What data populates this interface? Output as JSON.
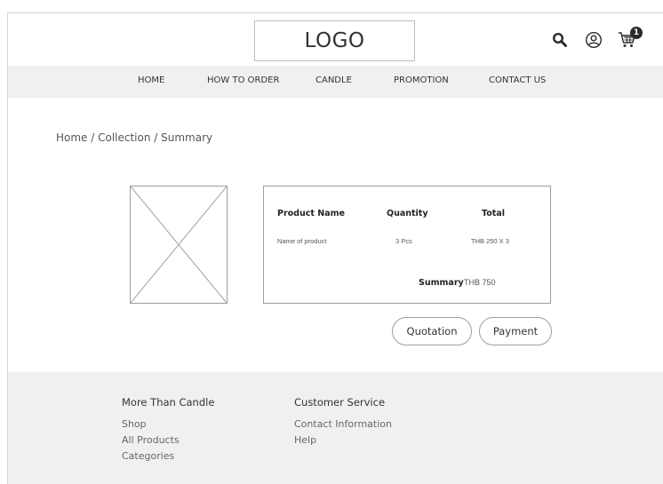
{
  "header": {
    "logo": "LOGO",
    "icons": [
      "search-icon",
      "user-icon",
      "cart-icon"
    ],
    "cart_count": "1"
  },
  "nav": {
    "items": [
      "HOME",
      "HOW TO ORDER",
      "CANDLE",
      "PROMOTION",
      "CONTACT US"
    ]
  },
  "breadcrumb": "Home / Collection / Summary",
  "summary": {
    "headers": {
      "product": "Product Name",
      "quantity": "Quantity",
      "total": "Total"
    },
    "row": {
      "product": "Name of product",
      "quantity": "3 Pcs",
      "total": "THB 250  X  3"
    },
    "summary_label": "Summary",
    "summary_value": "THB 750"
  },
  "actions": {
    "quotation": "Quotation",
    "payment": "Payment"
  },
  "footer": {
    "col1": {
      "heading": "More Than Candle",
      "links": [
        "Shop",
        "All Products",
        "Categories"
      ]
    },
    "col2": {
      "heading": "Customer Service",
      "links": [
        "Contact Information",
        "Help"
      ]
    }
  },
  "colors": {
    "nav_bg": "#f0f0f0",
    "footer_bg": "#f0f0f0",
    "border": "#9e9e9e",
    "text": "#333333"
  }
}
